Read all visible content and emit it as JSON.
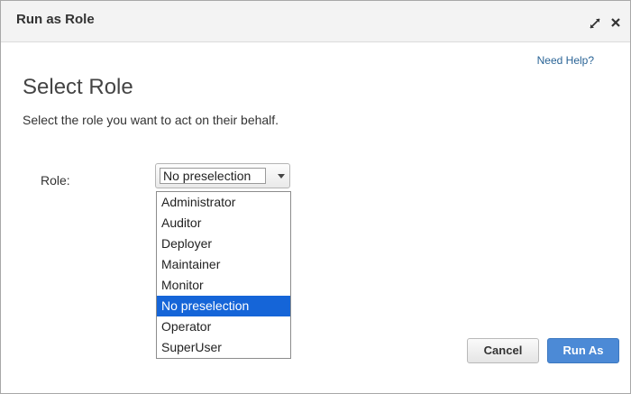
{
  "dialog": {
    "title": "Run as Role",
    "help_link": "Need Help?",
    "heading": "Select Role",
    "description": "Select the role you want to act on their behalf."
  },
  "form": {
    "role_label": "Role:",
    "role_selected": "No preselection",
    "role_options": [
      "Administrator",
      "Auditor",
      "Deployer",
      "Maintainer",
      "Monitor",
      "No preselection",
      "Operator",
      "SuperUser"
    ],
    "highlighted_option": "No preselection"
  },
  "buttons": {
    "cancel": "Cancel",
    "run_as": "Run As"
  },
  "colors": {
    "selection": "#1565d8",
    "primary_button": "#4c8ad6"
  },
  "icons": {
    "resize": "expand-arrows-icon",
    "close": "close-icon"
  }
}
